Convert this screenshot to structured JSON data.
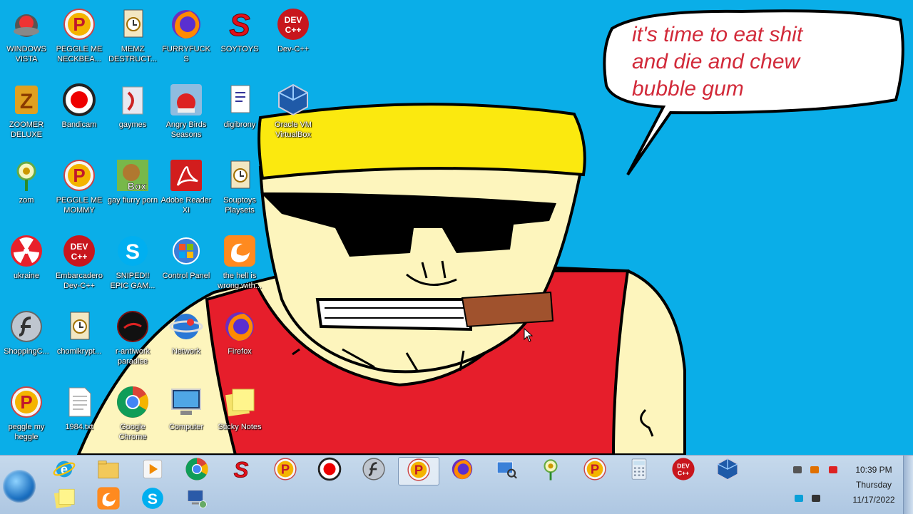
{
  "desktop": {
    "speech_bubble_lines": [
      "it's time to eat shit",
      "and die and chew",
      "bubble gum"
    ],
    "icons": [
      {
        "label": "WINDOWS VISTA",
        "icon": "vista-app-icon"
      },
      {
        "label": "PEGGLE ME NECKBEA...",
        "icon": "peggle-icon"
      },
      {
        "label": "MEMZ DESTRUCT...",
        "icon": "document-clock-icon"
      },
      {
        "label": "FURRYFUCKS",
        "icon": "firefox-icon"
      },
      {
        "label": "SOYTOYS",
        "icon": "soytoys-s-icon"
      },
      {
        "label": "Dev-C++",
        "icon": "devcpp-icon"
      },
      {
        "label": "ZOOMER DELUXE",
        "icon": "zuma-icon"
      },
      {
        "label": "Bandicam",
        "icon": "bandicam-icon"
      },
      {
        "label": "gaymes",
        "icon": "games-folder-icon"
      },
      {
        "label": "Angry Birds Seasons",
        "icon": "angry-birds-icon"
      },
      {
        "label": "digibrony",
        "icon": "document-icon"
      },
      {
        "label": "Oracle VM VirtualBox",
        "icon": "virtualbox-icon"
      },
      {
        "label": "zom",
        "icon": "plants-vs-zombies-icon"
      },
      {
        "label": "PEGGLE ME MOMMY",
        "icon": "peggle-icon"
      },
      {
        "label": "gay fiurry porn",
        "icon": "box-game-icon"
      },
      {
        "label": "Adobe Reader XI",
        "icon": "adobe-reader-icon"
      },
      {
        "label": "Souptoys Playsets",
        "icon": "document-clock-icon"
      },
      {
        "label": "ukraine",
        "icon": "radiation-icon"
      },
      {
        "label": "Embarcadero Dev-C++",
        "icon": "devcpp-icon"
      },
      {
        "label": "SNIPED!! EPIC GAM...",
        "icon": "skype-icon"
      },
      {
        "label": "Control Panel",
        "icon": "control-panel-icon"
      },
      {
        "label": "the hell is wrong with...",
        "icon": "uc-browser-icon"
      },
      {
        "label": "ShoppingC...",
        "icon": "flash-icon"
      },
      {
        "label": "chomikrypt...",
        "icon": "document-clock-icon"
      },
      {
        "label": "r-antiwork paradise",
        "icon": "dark-circle-icon"
      },
      {
        "label": "Network",
        "icon": "network-icon"
      },
      {
        "label": "Firefox",
        "icon": "firefox-icon"
      },
      {
        "label": "peggle my heggle",
        "icon": "peggle-icon"
      },
      {
        "label": "1984.txt",
        "icon": "text-file-icon"
      },
      {
        "label": "Google Chrome",
        "icon": "chrome-icon"
      },
      {
        "label": "Computer",
        "icon": "computer-icon"
      },
      {
        "label": "Sticky Notes",
        "icon": "sticky-notes-icon"
      }
    ]
  },
  "taskbar": {
    "start_label": "Start",
    "pinned": [
      {
        "icon": "ie-icon"
      },
      {
        "icon": "explorer-folder-icon"
      },
      {
        "icon": "media-player-icon"
      },
      {
        "icon": "chrome-icon"
      },
      {
        "icon": "soytoys-s-icon"
      },
      {
        "icon": "peggle-icon"
      },
      {
        "icon": "bandicam-icon"
      },
      {
        "icon": "flash-icon"
      },
      {
        "icon": "peggle-icon",
        "active": true
      },
      {
        "icon": "firefox-icon"
      },
      {
        "icon": "network-search-icon"
      },
      {
        "icon": "plants-vs-zombies-icon"
      },
      {
        "icon": "peggle-icon"
      },
      {
        "icon": "calculator-icon"
      },
      {
        "icon": "devcpp-icon"
      },
      {
        "icon": "virtualbox-icon"
      },
      {
        "icon": "sticky-notes-icon"
      },
      {
        "icon": "uc-browser-icon"
      },
      {
        "icon": "skype-icon"
      },
      {
        "icon": "network-computer-icon"
      }
    ],
    "tray_icons": [
      "tray-network-icon",
      "tray-search-icon",
      "tray-flag-icon",
      "tray-display-icon",
      "tray-volume-icon"
    ],
    "clock": {
      "time": "10:39 PM",
      "day": "Thursday",
      "date": "11/17/2022"
    }
  },
  "colors": {
    "desktop_bg": "#0aaee8",
    "taskbar_bg": "#b9d0e8",
    "bubble_text": "#d22a3a"
  }
}
